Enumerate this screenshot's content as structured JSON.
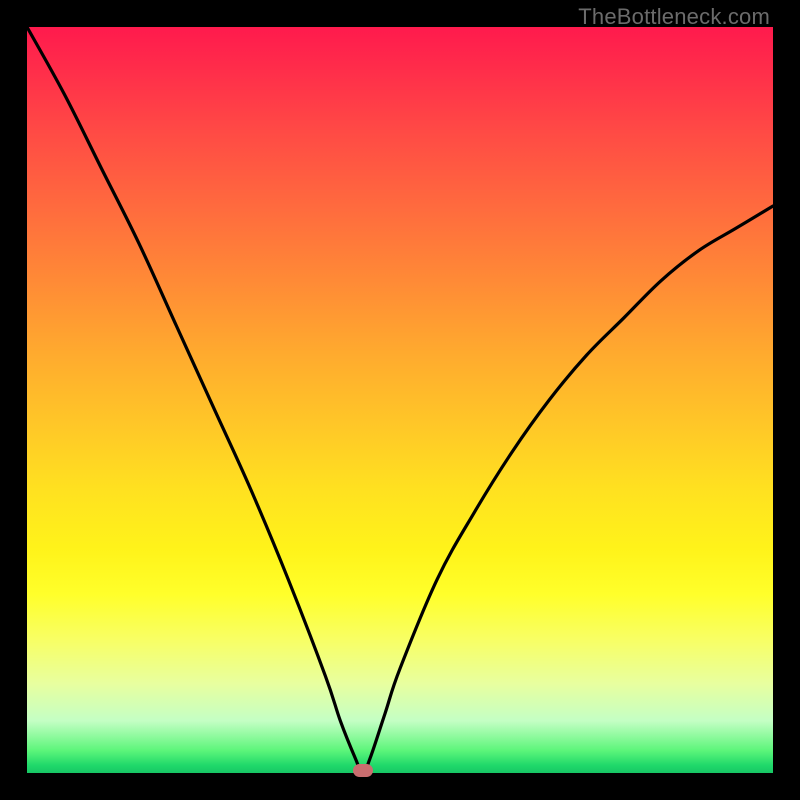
{
  "watermark": "TheBottleneck.com",
  "colors": {
    "frame": "#000000",
    "curve": "#000000",
    "marker": "#c96d6f"
  },
  "chart_data": {
    "type": "line",
    "title": "",
    "xlabel": "",
    "ylabel": "",
    "xlim": [
      0,
      100
    ],
    "ylim": [
      0,
      100
    ],
    "background_gradient": {
      "top": "#ff1a4d",
      "mid": "#ffe120",
      "bottom": "#17c765"
    },
    "series": [
      {
        "name": "bottleneck-curve",
        "x": [
          0,
          5,
          10,
          15,
          20,
          25,
          30,
          35,
          40,
          42,
          44,
          45,
          46,
          48,
          50,
          55,
          60,
          65,
          70,
          75,
          80,
          85,
          90,
          95,
          100
        ],
        "y": [
          100,
          91,
          81,
          71,
          60,
          49,
          38,
          26,
          13,
          7,
          2,
          0,
          2,
          8,
          14,
          26,
          35,
          43,
          50,
          56,
          61,
          66,
          70,
          73,
          76
        ]
      }
    ],
    "marker": {
      "x": 45,
      "y": 0
    }
  }
}
